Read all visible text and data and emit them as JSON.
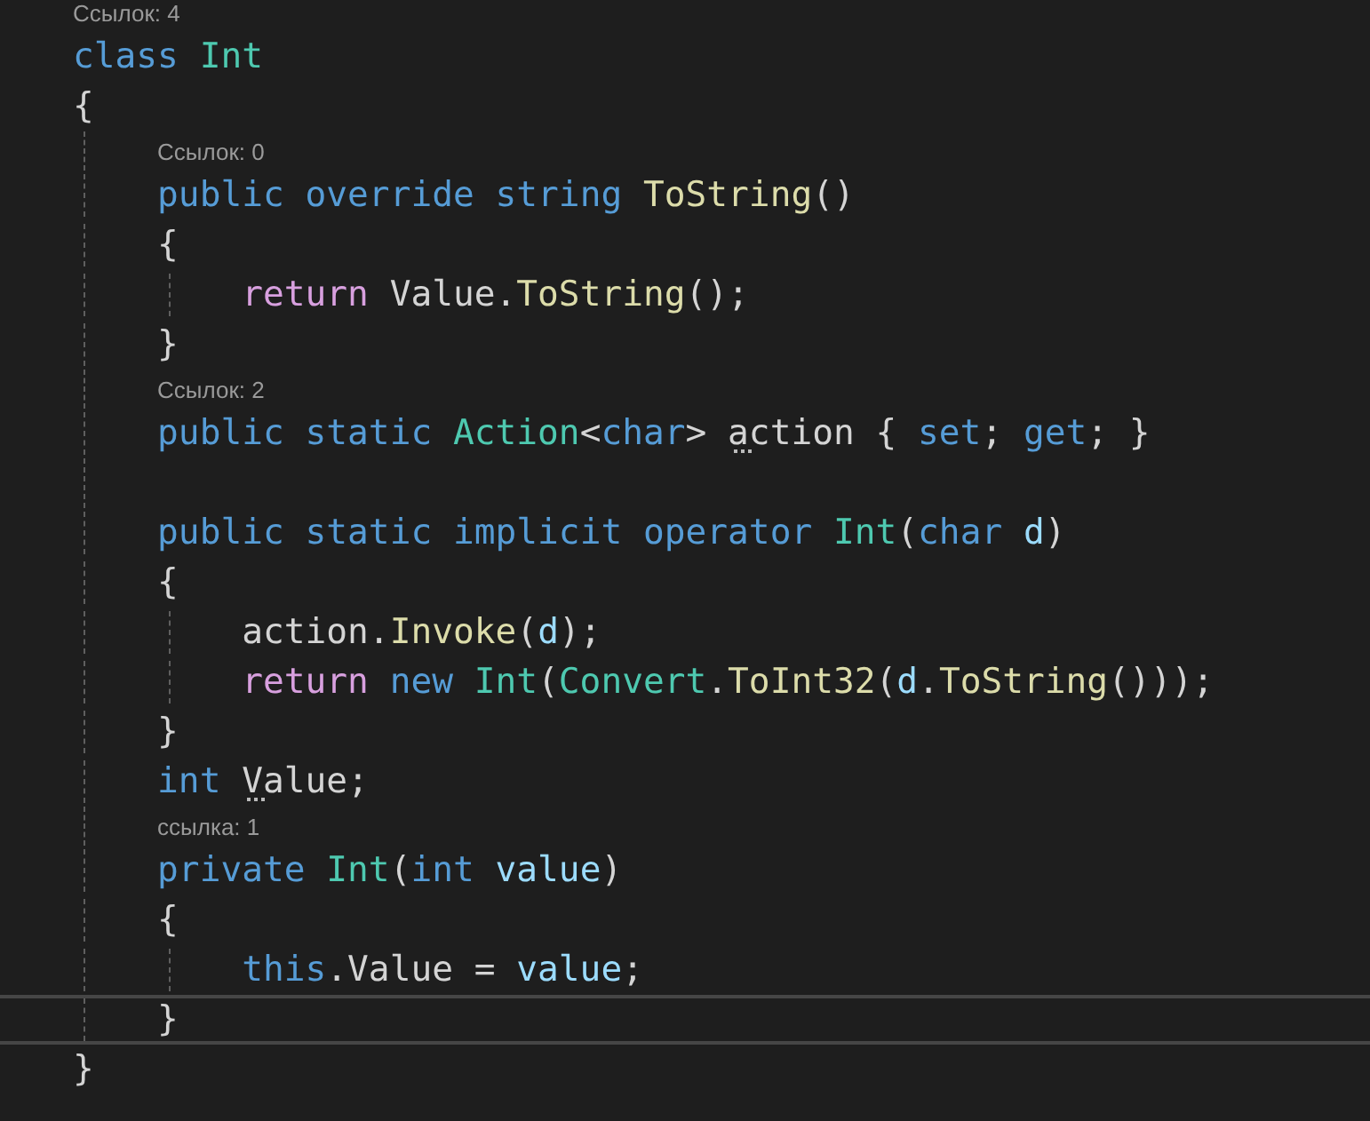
{
  "lines": [
    {
      "kind": "codelens",
      "text": "Ссылок: 4"
    },
    {
      "kind": "code",
      "current": false,
      "tokens": [
        {
          "text": "class",
          "kind": "kw"
        },
        {
          "text": "Int",
          "kind": "type",
          "gap": true
        }
      ]
    },
    {
      "kind": "code",
      "current": false,
      "tokens": [
        {
          "text": "{",
          "kind": "txt"
        }
      ],
      "children": [
        {
          "kind": "codelens",
          "text": "Ссылок: 0"
        },
        {
          "kind": "code",
          "current": false,
          "tokens": [
            {
              "text": "public",
              "kind": "kw"
            },
            {
              "text": "override",
              "kind": "kw",
              "gap": true
            },
            {
              "text": "string",
              "kind": "kw",
              "gap": true
            },
            {
              "text": "ToString",
              "kind": "fn",
              "gap": true
            },
            {
              "text": "()",
              "kind": "txt"
            }
          ]
        },
        {
          "kind": "code",
          "current": false,
          "tokens": [
            {
              "text": "{",
              "kind": "txt"
            }
          ],
          "children": [
            {
              "kind": "code",
              "current": false,
              "tokens": [
                {
                  "text": "return",
                  "kind": "ctl"
                },
                {
                  "text": "Value.",
                  "kind": "txt",
                  "gap": true
                },
                {
                  "text": "ToString",
                  "kind": "fn"
                },
                {
                  "text": "();",
                  "kind": "txt"
                }
              ]
            }
          ]
        },
        {
          "kind": "code",
          "current": false,
          "tokens": [
            {
              "text": "}",
              "kind": "txt"
            }
          ]
        },
        {
          "kind": "codelens",
          "text": "Ссылок: 2"
        },
        {
          "kind": "code",
          "current": false,
          "tokens": [
            {
              "text": "public",
              "kind": "kw"
            },
            {
              "text": "static",
              "kind": "kw",
              "gap": true
            },
            {
              "text": "Action",
              "kind": "type",
              "gap": true
            },
            {
              "text": "<",
              "kind": "txt"
            },
            {
              "text": "char",
              "kind": "kw"
            },
            {
              "text": ">",
              "kind": "txt"
            },
            {
              "text": "action",
              "kind": "txt",
              "gap": true,
              "hint": true
            },
            {
              "text": "{",
              "kind": "txt",
              "gap": true
            },
            {
              "text": "set",
              "kind": "kw",
              "gap": true
            },
            {
              "text": ";",
              "kind": "txt"
            },
            {
              "text": "get",
              "kind": "kw",
              "gap": true
            },
            {
              "text": ";",
              "kind": "txt"
            },
            {
              "text": "}",
              "kind": "txt",
              "gap": true
            }
          ]
        },
        {
          "kind": "blank"
        },
        {
          "kind": "code",
          "current": false,
          "tokens": [
            {
              "text": "public",
              "kind": "kw"
            },
            {
              "text": "static",
              "kind": "kw",
              "gap": true
            },
            {
              "text": "implicit",
              "kind": "kw",
              "gap": true
            },
            {
              "text": "operator",
              "kind": "kw",
              "gap": true
            },
            {
              "text": "Int",
              "kind": "type",
              "gap": true
            },
            {
              "text": "(",
              "kind": "txt"
            },
            {
              "text": "char",
              "kind": "kw"
            },
            {
              "text": "d",
              "kind": "var",
              "gap": true
            },
            {
              "text": ")",
              "kind": "txt"
            }
          ]
        },
        {
          "kind": "code",
          "current": false,
          "tokens": [
            {
              "text": "{",
              "kind": "txt"
            }
          ],
          "children": [
            {
              "kind": "code",
              "current": false,
              "tokens": [
                {
                  "text": "action.",
                  "kind": "txt"
                },
                {
                  "text": "Invoke",
                  "kind": "fn"
                },
                {
                  "text": "(",
                  "kind": "txt"
                },
                {
                  "text": "d",
                  "kind": "var"
                },
                {
                  "text": ");",
                  "kind": "txt"
                }
              ]
            },
            {
              "kind": "code",
              "current": false,
              "tokens": [
                {
                  "text": "return",
                  "kind": "ctl"
                },
                {
                  "text": "new",
                  "kind": "kw",
                  "gap": true
                },
                {
                  "text": "Int",
                  "kind": "type",
                  "gap": true
                },
                {
                  "text": "(",
                  "kind": "txt"
                },
                {
                  "text": "Convert",
                  "kind": "type"
                },
                {
                  "text": ".",
                  "kind": "txt"
                },
                {
                  "text": "ToInt32",
                  "kind": "fn"
                },
                {
                  "text": "(",
                  "kind": "txt"
                },
                {
                  "text": "d",
                  "kind": "var"
                },
                {
                  "text": ".",
                  "kind": "txt"
                },
                {
                  "text": "ToString",
                  "kind": "fn"
                },
                {
                  "text": "()));",
                  "kind": "txt"
                }
              ]
            }
          ]
        },
        {
          "kind": "code",
          "current": false,
          "tokens": [
            {
              "text": "}",
              "kind": "txt"
            }
          ]
        },
        {
          "kind": "code",
          "current": false,
          "tokens": [
            {
              "text": "int",
              "kind": "kw"
            },
            {
              "text": "Value",
              "kind": "txt",
              "gap": true,
              "hint": true
            },
            {
              "text": ";",
              "kind": "txt"
            }
          ]
        },
        {
          "kind": "codelens",
          "text": "ссылка: 1"
        },
        {
          "kind": "code",
          "current": false,
          "tokens": [
            {
              "text": "private",
              "kind": "kw"
            },
            {
              "text": "Int",
              "kind": "type",
              "gap": true
            },
            {
              "text": "(",
              "kind": "txt"
            },
            {
              "text": "int",
              "kind": "kw"
            },
            {
              "text": "value",
              "kind": "var",
              "gap": true
            },
            {
              "text": ")",
              "kind": "txt"
            }
          ]
        },
        {
          "kind": "code",
          "current": false,
          "tokens": [
            {
              "text": "{",
              "kind": "txt"
            }
          ],
          "children": [
            {
              "kind": "code",
              "current": false,
              "tokens": [
                {
                  "text": "this",
                  "kind": "kw"
                },
                {
                  "text": ".Value",
                  "kind": "txt"
                },
                {
                  "text": "=",
                  "kind": "txt",
                  "gap": true
                },
                {
                  "text": "value",
                  "kind": "var",
                  "gap": true
                },
                {
                  "text": ";",
                  "kind": "txt"
                }
              ]
            }
          ]
        },
        {
          "kind": "code",
          "current": true,
          "tokens": [
            {
              "text": "}",
              "kind": "txt"
            }
          ]
        }
      ]
    },
    {
      "kind": "code",
      "current": false,
      "tokens": [
        {
          "text": "}",
          "kind": "txt"
        }
      ]
    }
  ]
}
